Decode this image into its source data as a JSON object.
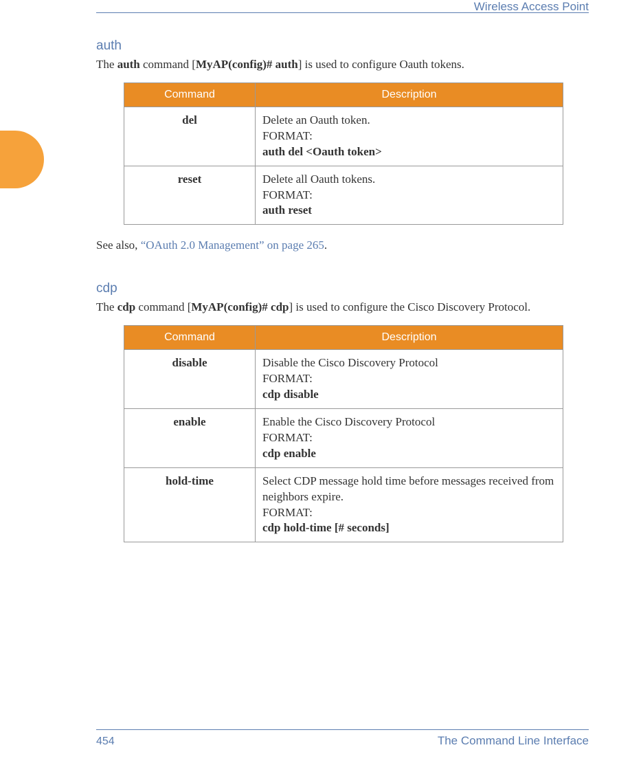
{
  "header": {
    "title": "Wireless Access Point"
  },
  "sections": {
    "auth": {
      "title": "auth",
      "intro_prefix": "The ",
      "intro_cmd": "auth",
      "intro_mid": " command [",
      "intro_prompt": "MyAP(config)# auth",
      "intro_suffix": "] is used to configure Oauth tokens.",
      "table": {
        "col1": "Command",
        "col2": "Description",
        "rows": [
          {
            "cmd": "del",
            "d1": "Delete an Oauth token.",
            "d2": "FORMAT:",
            "d3": "auth del <Oauth token>"
          },
          {
            "cmd": "reset",
            "d1": "Delete all Oauth tokens.",
            "d2": "FORMAT:",
            "d3": "auth reset"
          }
        ]
      },
      "seealso_prefix": "See also, ",
      "seealso_link": "“OAuth 2.0 Management” on page 265",
      "seealso_suffix": "."
    },
    "cdp": {
      "title": "cdp",
      "intro_prefix": "The ",
      "intro_cmd": "cdp",
      "intro_mid": " command [",
      "intro_prompt": "MyAP(config)# cdp",
      "intro_suffix": "] is used to configure the Cisco Discovery Protocol.",
      "table": {
        "col1": "Command",
        "col2": "Description",
        "rows": [
          {
            "cmd": "disable",
            "d1": "Disable the Cisco Discovery Protocol",
            "d2": "FORMAT:",
            "d3": "cdp disable"
          },
          {
            "cmd": "enable",
            "d1": "Enable the Cisco Discovery Protocol",
            "d2": "FORMAT:",
            "d3": "cdp enable"
          },
          {
            "cmd": "hold-time",
            "d1": " Select CDP message hold time before messages received from neighbors expire.",
            "d2": "FORMAT:",
            "d3": "cdp hold-time [# seconds]"
          }
        ]
      }
    }
  },
  "footer": {
    "page": "454",
    "section": "The Command Line Interface"
  }
}
